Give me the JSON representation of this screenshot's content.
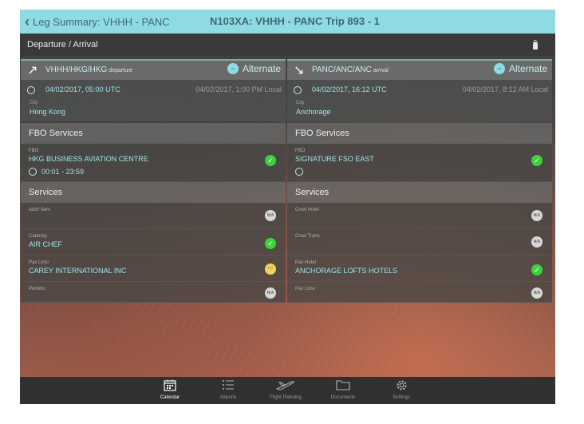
{
  "nav": {
    "back_label": "Leg Summary: VHHH - PANC",
    "title": "N103XA: VHHH - PANC  Trip 893 - 1"
  },
  "section": {
    "title": "Departure / Arrival"
  },
  "departure": {
    "code": "VHHH/HKG/HKG",
    "tag": "departure",
    "alternate_label": "Alternate",
    "utc_time": "04/02/2017, 05:00  UTC",
    "local_time": "04/02/2017, 1:00 PM  Local",
    "city_label": "City",
    "city": "Hong Kong",
    "fbo_header": "FBO Services",
    "fbo_label": "FBO",
    "fbo_name": "HKG BUSINESS AVIATION CENTRE",
    "fbo_hours": "00:01 - 23:59",
    "services_header": "Services",
    "services": [
      {
        "label": "Add'l Serv",
        "value": "",
        "status": "N/A"
      },
      {
        "label": "Catering",
        "value": "AIR CHEF",
        "status": "ok"
      },
      {
        "label": "Pax Limo",
        "value": "CAREY INTERNATIONAL INC",
        "status": "pending"
      },
      {
        "label": "Permits",
        "value": "",
        "status": "N/A"
      }
    ]
  },
  "arrival": {
    "code": "PANC/ANC/ANC",
    "tag": "arrival",
    "alternate_label": "Alternate",
    "utc_time": "04/02/2017, 16:12  UTC",
    "local_time": "04/02/2017, 8:12 AM  Local",
    "city_label": "City",
    "city": "Anchorage",
    "fbo_header": "FBO Services",
    "fbo_label": "FBO",
    "fbo_name": "SIGNATURE FSO EAST",
    "fbo_hours": "",
    "services_header": "Services",
    "services": [
      {
        "label": "Crew Hotel",
        "value": "",
        "status": "N/A"
      },
      {
        "label": "Crew Trans",
        "value": "",
        "status": "N/A"
      },
      {
        "label": "Pax Hotel",
        "value": "ANCHORAGE LOFTS HOTELS",
        "status": "ok"
      },
      {
        "label": "Pax Limo",
        "value": "",
        "status": "N/A"
      }
    ]
  },
  "status_glyphs": {
    "ok": "✓",
    "na": "N/A",
    "pending": "···"
  },
  "tabs": [
    {
      "label": "Calendar",
      "icon": "calendar-icon"
    },
    {
      "label": "Airports",
      "icon": "list-icon"
    },
    {
      "label": "Flight Planning",
      "icon": "plane-icon"
    },
    {
      "label": "Documents",
      "icon": "folder-icon"
    },
    {
      "label": "Settings",
      "icon": "gear-icon"
    }
  ],
  "colors": {
    "accent": "#8fdbe4",
    "ok": "#3cd23c",
    "pending": "#f1d35a"
  }
}
